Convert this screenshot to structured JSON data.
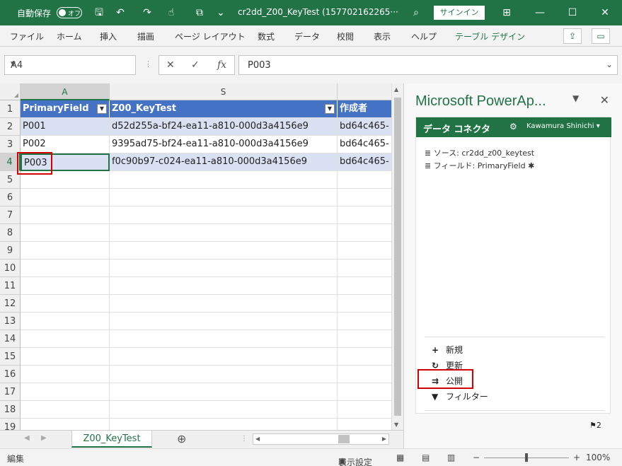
{
  "titlebar": {
    "autosave_label": "自動保存",
    "autosave_state": "オフ",
    "doc_title": "cr2dd_Z00_KeyTest (157702162265···",
    "signin_label": "サインイン"
  },
  "ribbon": {
    "tabs": [
      "ファイル",
      "ホーム",
      "挿入",
      "描画",
      "ページ レイアウト",
      "数式",
      "データ",
      "校閲",
      "表示",
      "ヘルプ",
      "テーブル デザイン"
    ]
  },
  "formula_bar": {
    "name_box": "A4",
    "fx_label": "fx",
    "value": "P003"
  },
  "sheet": {
    "columns": [
      "A",
      "S",
      ""
    ],
    "rows": [
      "1",
      "2",
      "3",
      "4",
      "5",
      "6",
      "7",
      "8",
      "9",
      "10",
      "11",
      "12",
      "13",
      "14",
      "15",
      "16",
      "17",
      "18",
      "19"
    ],
    "headers": [
      "PrimaryField",
      "Z00_KeyTest",
      "作成者"
    ],
    "data": [
      [
        "P001",
        "d52d255a-bf24-ea11-a810-000d3a4156e9",
        "bd64c465-"
      ],
      [
        "P002",
        "9395ad75-bf24-ea11-a810-000d3a4156e9",
        "bd64c465-"
      ],
      [
        "P003",
        "f0c90b97-c024-ea11-a810-000d3a4156e9",
        "bd64c465-"
      ]
    ],
    "active_tab": "Z00_KeyTest"
  },
  "pane": {
    "title": "Microsoft PowerAp...",
    "header": "データ コネクタ",
    "user": "Kawamura Shinichi",
    "source": "ソース: cr2dd_z00_keytest",
    "field": "フィールド: PrimaryField ✱",
    "actions": {
      "new": "新規",
      "refresh": "更新",
      "publish": "公開",
      "filter": "フィルター"
    },
    "flag_count": "2"
  },
  "status": {
    "mode": "編集",
    "display_settings": "表示設定",
    "zoom": "100%"
  },
  "colors": {
    "excel_green": "#217346",
    "table_header": "#4472c4",
    "table_band": "#d9e1f2",
    "highlight": "#d40000"
  }
}
